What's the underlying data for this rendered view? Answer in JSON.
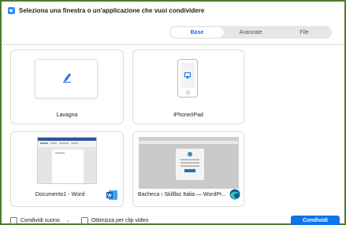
{
  "window": {
    "title": "Seleziona una finestra o un'applicazione che vuoi condividere",
    "frame_color": "#4e7a2c"
  },
  "tabs": [
    {
      "label": "Base",
      "active": true
    },
    {
      "label": "Avanzate",
      "active": false
    },
    {
      "label": "File",
      "active": false
    }
  ],
  "cards": {
    "whiteboard": {
      "label": "Lavagna",
      "icon": "pencil-icon"
    },
    "iphone": {
      "label": "iPhone/iPad",
      "icon": "airplay-icon"
    },
    "word": {
      "label": "Documento1 - Word",
      "icon": "word-icon"
    },
    "edge": {
      "label": "Bacheca ‹ Skillbiz Italia — WordPr...",
      "icon": "edge-icon"
    }
  },
  "bottom": {
    "share_sound": "Condividi suono",
    "optimize_video": "Ottimizza per clip video",
    "share_button": "Condividi"
  },
  "colors": {
    "accent": "#0e72ed"
  }
}
